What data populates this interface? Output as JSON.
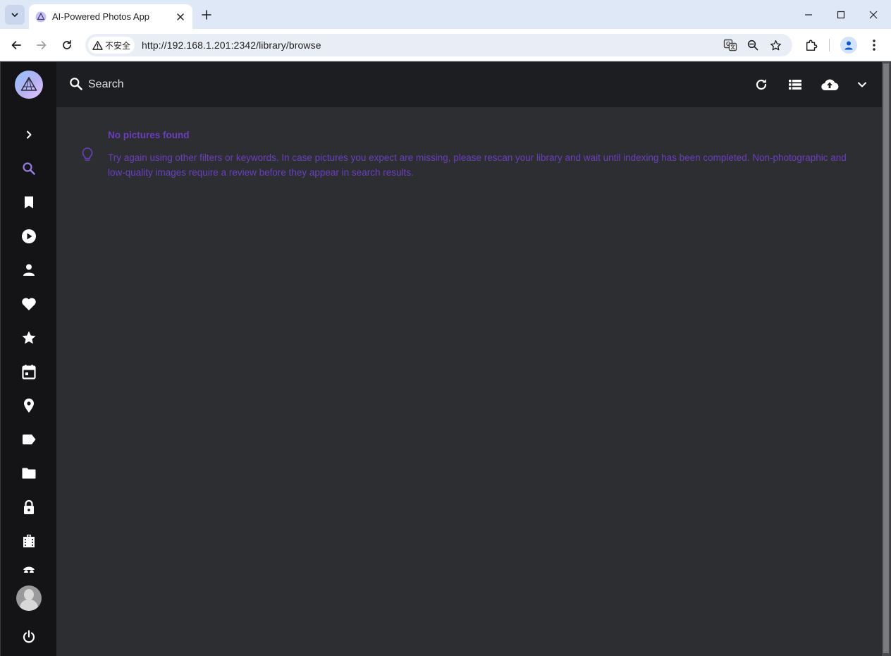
{
  "browser": {
    "tab_title": "AI-Powered Photos App",
    "security_label": "不安全",
    "url": "http://192.168.1.201:2342/library/browse"
  },
  "app": {
    "search": {
      "placeholder": "Search"
    },
    "nav": [
      {
        "name": "expand",
        "icon": "chevron-right-icon"
      },
      {
        "name": "search",
        "icon": "search-icon",
        "active": true
      },
      {
        "name": "albums",
        "icon": "bookmark-icon"
      },
      {
        "name": "videos",
        "icon": "play-circle-icon"
      },
      {
        "name": "people",
        "icon": "person-icon"
      },
      {
        "name": "favorites",
        "icon": "heart-icon"
      },
      {
        "name": "moments",
        "icon": "star-icon"
      },
      {
        "name": "calendar",
        "icon": "calendar-icon"
      },
      {
        "name": "places",
        "icon": "map-pin-icon"
      },
      {
        "name": "labels",
        "icon": "label-icon"
      },
      {
        "name": "folders",
        "icon": "folder-icon"
      },
      {
        "name": "private",
        "icon": "lock-icon"
      },
      {
        "name": "library",
        "icon": "film-icon"
      },
      {
        "name": "more",
        "icon": "incognito-icon"
      }
    ],
    "empty_state": {
      "title": "No pictures found",
      "message": "Try again using other filters or keywords. In case pictures you expect are missing, please rescan your library and wait until indexing has been completed. Non-photographic and low-quality images require a review before they appear in search results."
    },
    "colors": {
      "accent": "#6a3fbf",
      "nav_active": "#9a7be0",
      "sidebar_bg": "#141417",
      "topbar_bg": "#1d1e21",
      "content_bg": "#2d2e31"
    }
  }
}
